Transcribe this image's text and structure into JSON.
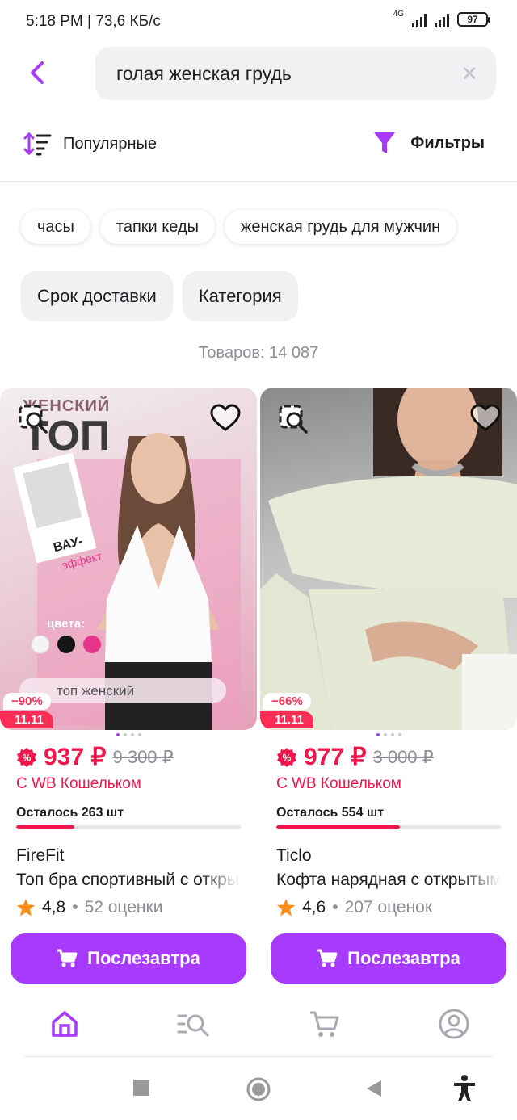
{
  "status": {
    "time": "5:18 PM | 73,6 КБ/с",
    "network": "4G",
    "battery": "97"
  },
  "search": {
    "query": "голая женская грудь"
  },
  "sort": {
    "label": "Популярные"
  },
  "filter": {
    "label": "Фильтры"
  },
  "suggestions": [
    "часы",
    "тапки кеды",
    "женская грудь для мужчин"
  ],
  "filter_chips": [
    "Срок доставки",
    "Категория"
  ],
  "count_text": "Товаров: 14 087",
  "products": [
    {
      "discount": "−90%",
      "sale_tag": "11.11",
      "price": "937 ₽",
      "old_price": "9 300 ₽",
      "wallet_text": "С WB Кошельком",
      "left_text": "Осталось 263 шт",
      "left_progress": 0.26,
      "brand": "FireFit",
      "name": "Топ бра спортивный с открытой спиной",
      "rating": "4,8",
      "reviews": "52 оценки",
      "buy_label": "Послезавтра",
      "photo_text": {
        "title_top": "ЖЕНСКИЙ",
        "title_main": "ТОП",
        "badge": "ВАУ-",
        "badge2": "эффект",
        "colors_label": "цвета:",
        "search_text": "топ женский"
      }
    },
    {
      "discount": "−66%",
      "sale_tag": "11.11",
      "price": "977 ₽",
      "old_price": "3 000 ₽",
      "wallet_text": "С WB Кошельком",
      "left_text": "Осталось 554 шт",
      "left_progress": 0.55,
      "brand": "Ticlo",
      "name": "Кофта нарядная с открытыми плечами",
      "rating": "4,6",
      "reviews": "207 оценок",
      "buy_label": "Послезавтра"
    }
  ],
  "colors": {
    "accent": "#a73afd",
    "price": "#f0154a",
    "star": "#ff8c1a"
  }
}
